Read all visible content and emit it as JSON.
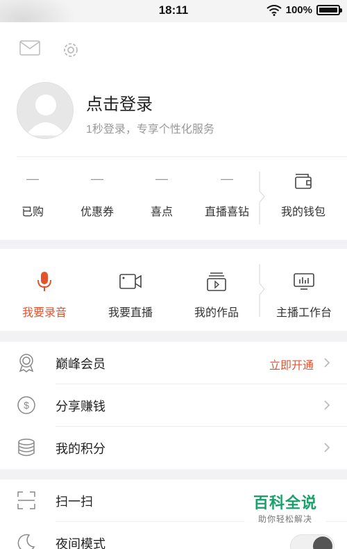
{
  "status_bar": {
    "time": "18:11",
    "battery_text": "100%",
    "icons": [
      "wifi-icon",
      "battery-icon"
    ]
  },
  "header": {
    "icons": [
      "mail-icon",
      "settings-icon"
    ],
    "login_title": "点击登录",
    "login_subtitle": "1秒登录，专享个性化服务"
  },
  "stats": [
    {
      "value": "—",
      "label": "已购"
    },
    {
      "value": "—",
      "label": "优惠券"
    },
    {
      "value": "—",
      "label": "喜点"
    },
    {
      "value": "—",
      "label": "直播喜钻"
    }
  ],
  "wallet": {
    "label": "我的钱包",
    "icon": "wallet-icon"
  },
  "actions": [
    {
      "label": "我要录音",
      "icon": "microphone-icon",
      "active": true
    },
    {
      "label": "我要直播",
      "icon": "video-camera-icon",
      "active": false
    },
    {
      "label": "我的作品",
      "icon": "works-icon",
      "active": false
    }
  ],
  "studio": {
    "label": "主播工作台",
    "icon": "studio-monitor-icon"
  },
  "list1": [
    {
      "label": "巅峰会员",
      "extra": "立即开通",
      "icon": "vip-badge-icon"
    },
    {
      "label": "分享赚钱",
      "extra": "",
      "icon": "dollar-icon"
    },
    {
      "label": "我的积分",
      "extra": "",
      "icon": "coins-icon"
    }
  ],
  "list2": [
    {
      "label": "扫一扫",
      "icon": "scan-icon"
    },
    {
      "label": "夜间模式",
      "icon": "moon-icon",
      "toggle_on": true
    }
  ],
  "watermark": {
    "title": "百科全说",
    "subtitle": "助你轻松解决"
  },
  "colors": {
    "accent": "#e2532d",
    "watermark_green": "#1aa06b"
  }
}
